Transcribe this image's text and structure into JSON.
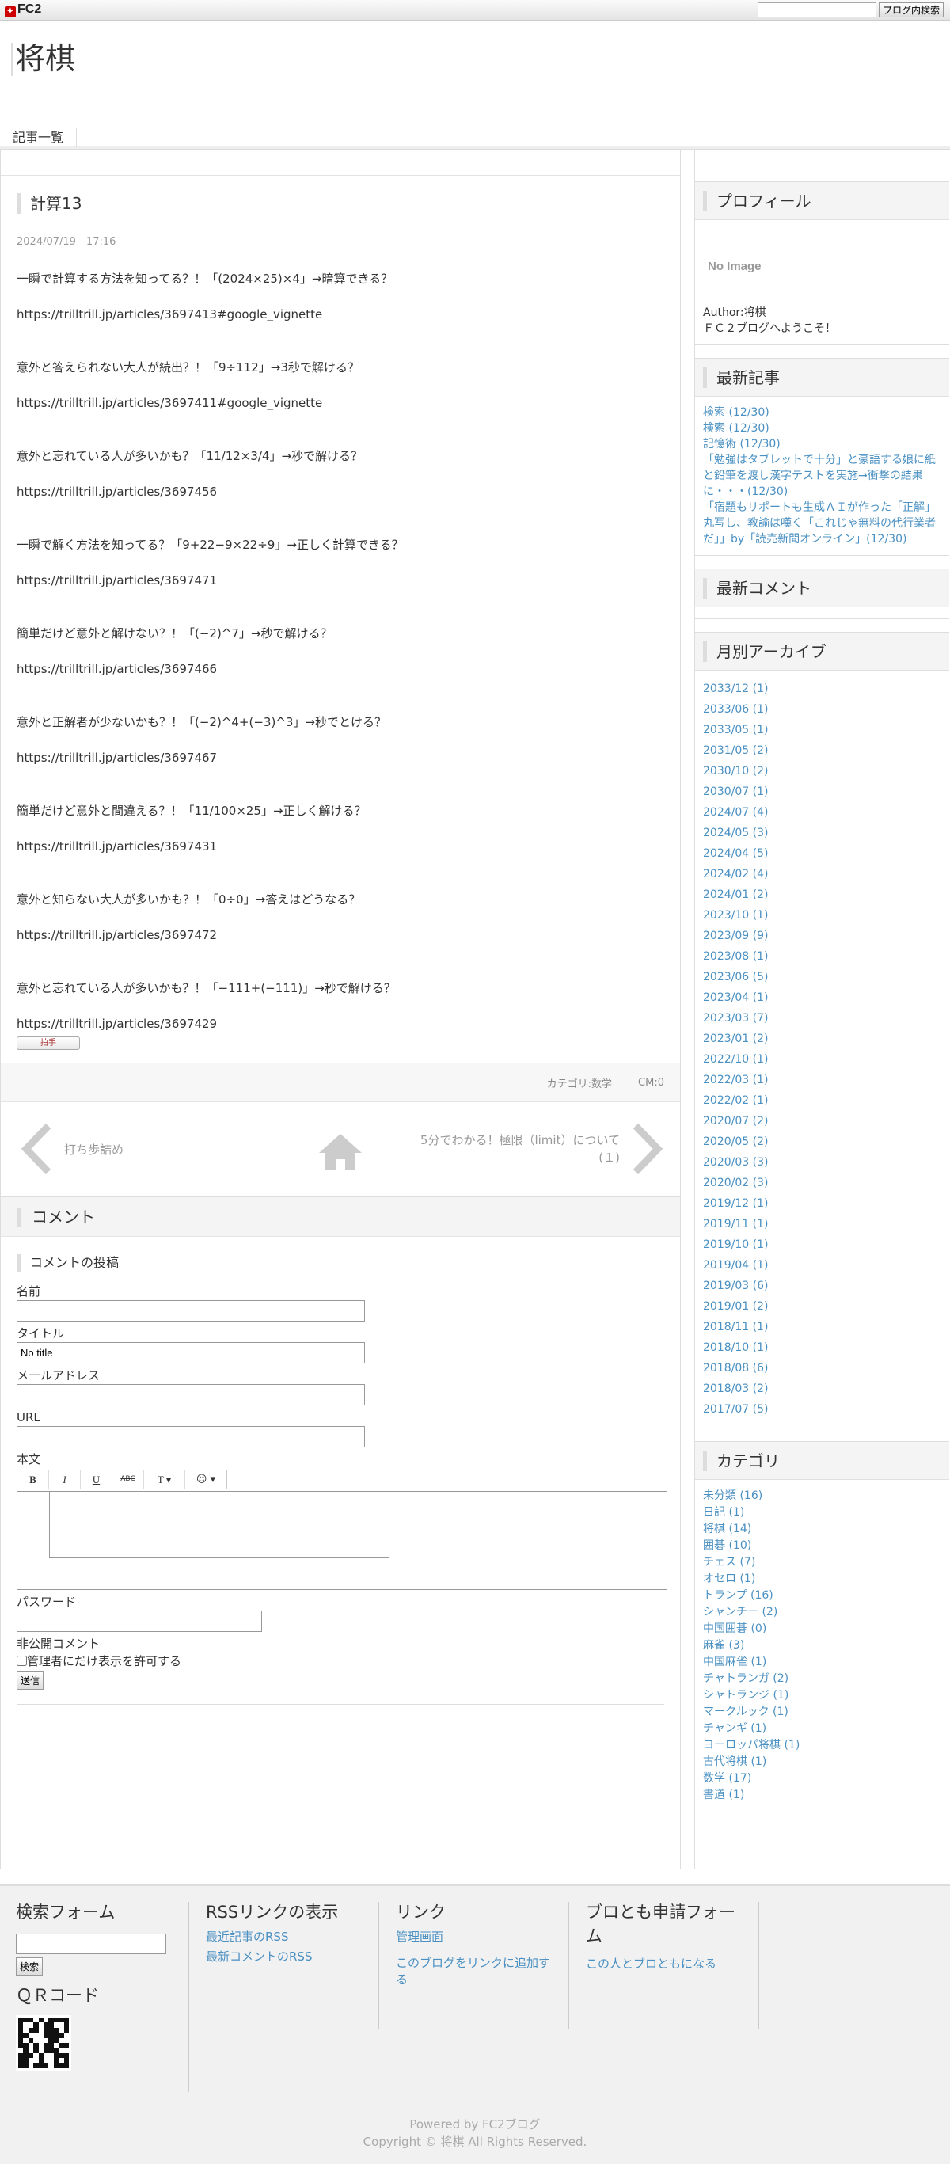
{
  "fc2bar": {
    "logo": "FC2",
    "search_button": "ブログ内検索"
  },
  "blog": {
    "title": "将棋"
  },
  "nav": {
    "item": "記事一覧"
  },
  "entry": {
    "title": "計算13",
    "date": "2024/07/19　17:16",
    "lines": [
      "一瞬で計算する方法を知ってる？！「(2024×25)×4」→暗算できる？",
      "https://trilltrill.jp/articles/3697413#google_vignette",
      "意外と答えられない大人が続出？！「9÷112」→3秒で解ける？",
      "https://trilltrill.jp/articles/3697411#google_vignette",
      "意外と忘れている人が多いかも？「11/12×3/4」→秒で解ける？",
      "https://trilltrill.jp/articles/3697456",
      "一瞬で解く方法を知ってる？「9+22−9×22÷9」→正しく計算できる？",
      "https://trilltrill.jp/articles/3697471",
      "簡単だけど意外と解けない？！「(−2)^7」→秒で解ける？",
      "https://trilltrill.jp/articles/3697466",
      "意外と正解者が少ないかも？！「(−2)^4+(−3)^3」→秒でとける？",
      "https://trilltrill.jp/articles/3697467",
      "簡単だけど意外と間違える？！「11/100×25」→正しく解ける？",
      "https://trilltrill.jp/articles/3697431",
      "意外と知らない大人が多いかも？！「0÷0」→答えはどうなる？",
      "https://trilltrill.jp/articles/3697472",
      "意外と忘れている人が多いかも？！「−111+(−111)」→秒で解ける？",
      "https://trilltrill.jp/articles/3697429"
    ],
    "clap": "拍手",
    "category": "カテゴリ:数学",
    "cm": "CM:0"
  },
  "pager": {
    "prev": "打ち歩詰め",
    "next": "5分でわかる！極限（limit）について(１)"
  },
  "comment": {
    "heading": "コメント",
    "form_title": "コメントの投稿",
    "name_label": "名前",
    "title_label": "タイトル",
    "title_value": "No title",
    "mail_label": "メールアドレス",
    "url_label": "URL",
    "body_label": "本文",
    "password_label": "パスワード",
    "private_label": "非公開コメント",
    "private_check": "管理者にだけ表示を許可する",
    "submit": "送信",
    "toolbar": [
      "B",
      "I",
      "U",
      "ABC",
      "T ▾",
      "☺ ▾"
    ]
  },
  "sidebar": {
    "profile_h": "プロフィール",
    "no_image": "No Image",
    "author": "Author:将棋",
    "greeting": "ＦＣ２ブログへようこそ！",
    "recent_h": "最新記事",
    "recent": [
      "検索 (12/30)",
      "検索 (12/30)",
      "記憶術 (12/30)",
      "「勉強はタブレットで十分」と豪語する娘に紙と鉛筆を渡し漢字テストを実施→衝撃の結果に・・・(12/30)",
      "「宿題もリポートも生成ＡＩが作った「正解」丸写し、教諭は嘆く「これじゃ無料の代行業者だ」」by「読売新聞オンライン」(12/30)"
    ],
    "comments_h": "最新コメント",
    "archive_h": "月別アーカイブ",
    "archive": [
      "2033/12 (1)",
      "2033/06 (1)",
      "2033/05 (1)",
      "2031/05 (2)",
      "2030/10 (2)",
      "2030/07 (1)",
      "2024/07 (4)",
      "2024/05 (3)",
      "2024/04 (5)",
      "2024/02 (4)",
      "2024/01 (2)",
      "2023/10 (1)",
      "2023/09 (9)",
      "2023/08 (1)",
      "2023/06 (5)",
      "2023/04 (1)",
      "2023/03 (7)",
      "2023/01 (2)",
      "2022/10 (1)",
      "2022/03 (1)",
      "2022/02 (1)",
      "2020/07 (2)",
      "2020/05 (2)",
      "2020/03 (3)",
      "2020/02 (3)",
      "2019/12 (1)",
      "2019/11 (1)",
      "2019/10 (1)",
      "2019/04 (1)",
      "2019/03 (6)",
      "2019/01 (2)",
      "2018/11 (1)",
      "2018/10 (1)",
      "2018/08 (6)",
      "2018/03 (2)",
      "2017/07 (5)"
    ],
    "category_h": "カテゴリ",
    "categories": [
      "未分類 (16)",
      "日記 (1)",
      "将棋 (14)",
      "囲碁 (10)",
      "チェス (7)",
      "オセロ (1)",
      "トランプ (16)",
      "シャンチー (2)",
      "中国囲碁 (0)",
      "麻雀 (3)",
      "中国麻雀 (1)",
      "チャトランガ (2)",
      "シャトランジ (1)",
      "マークルック (1)",
      "チャンギ (1)",
      "ヨーロッパ将棋 (1)",
      "古代将棋 (1)",
      "数学 (17)",
      "書道 (1)"
    ]
  },
  "footer": {
    "search_h": "検索フォーム",
    "search_button": "検索",
    "qr_h": "ＱＲコード",
    "rss_h": "RSSリンクの表示",
    "rss_links": [
      "最近記事のRSS",
      "最新コメントのRSS"
    ],
    "link_h": "リンク",
    "links": [
      "管理画面",
      "このブログをリンクに追加する"
    ],
    "friend_h": "ブロとも申請フォーム",
    "friend_link": "この人とブロともになる",
    "powered": "Powered by FC2ブログ",
    "copyright": "Copyright © 将棋 All Rights Reserved."
  }
}
